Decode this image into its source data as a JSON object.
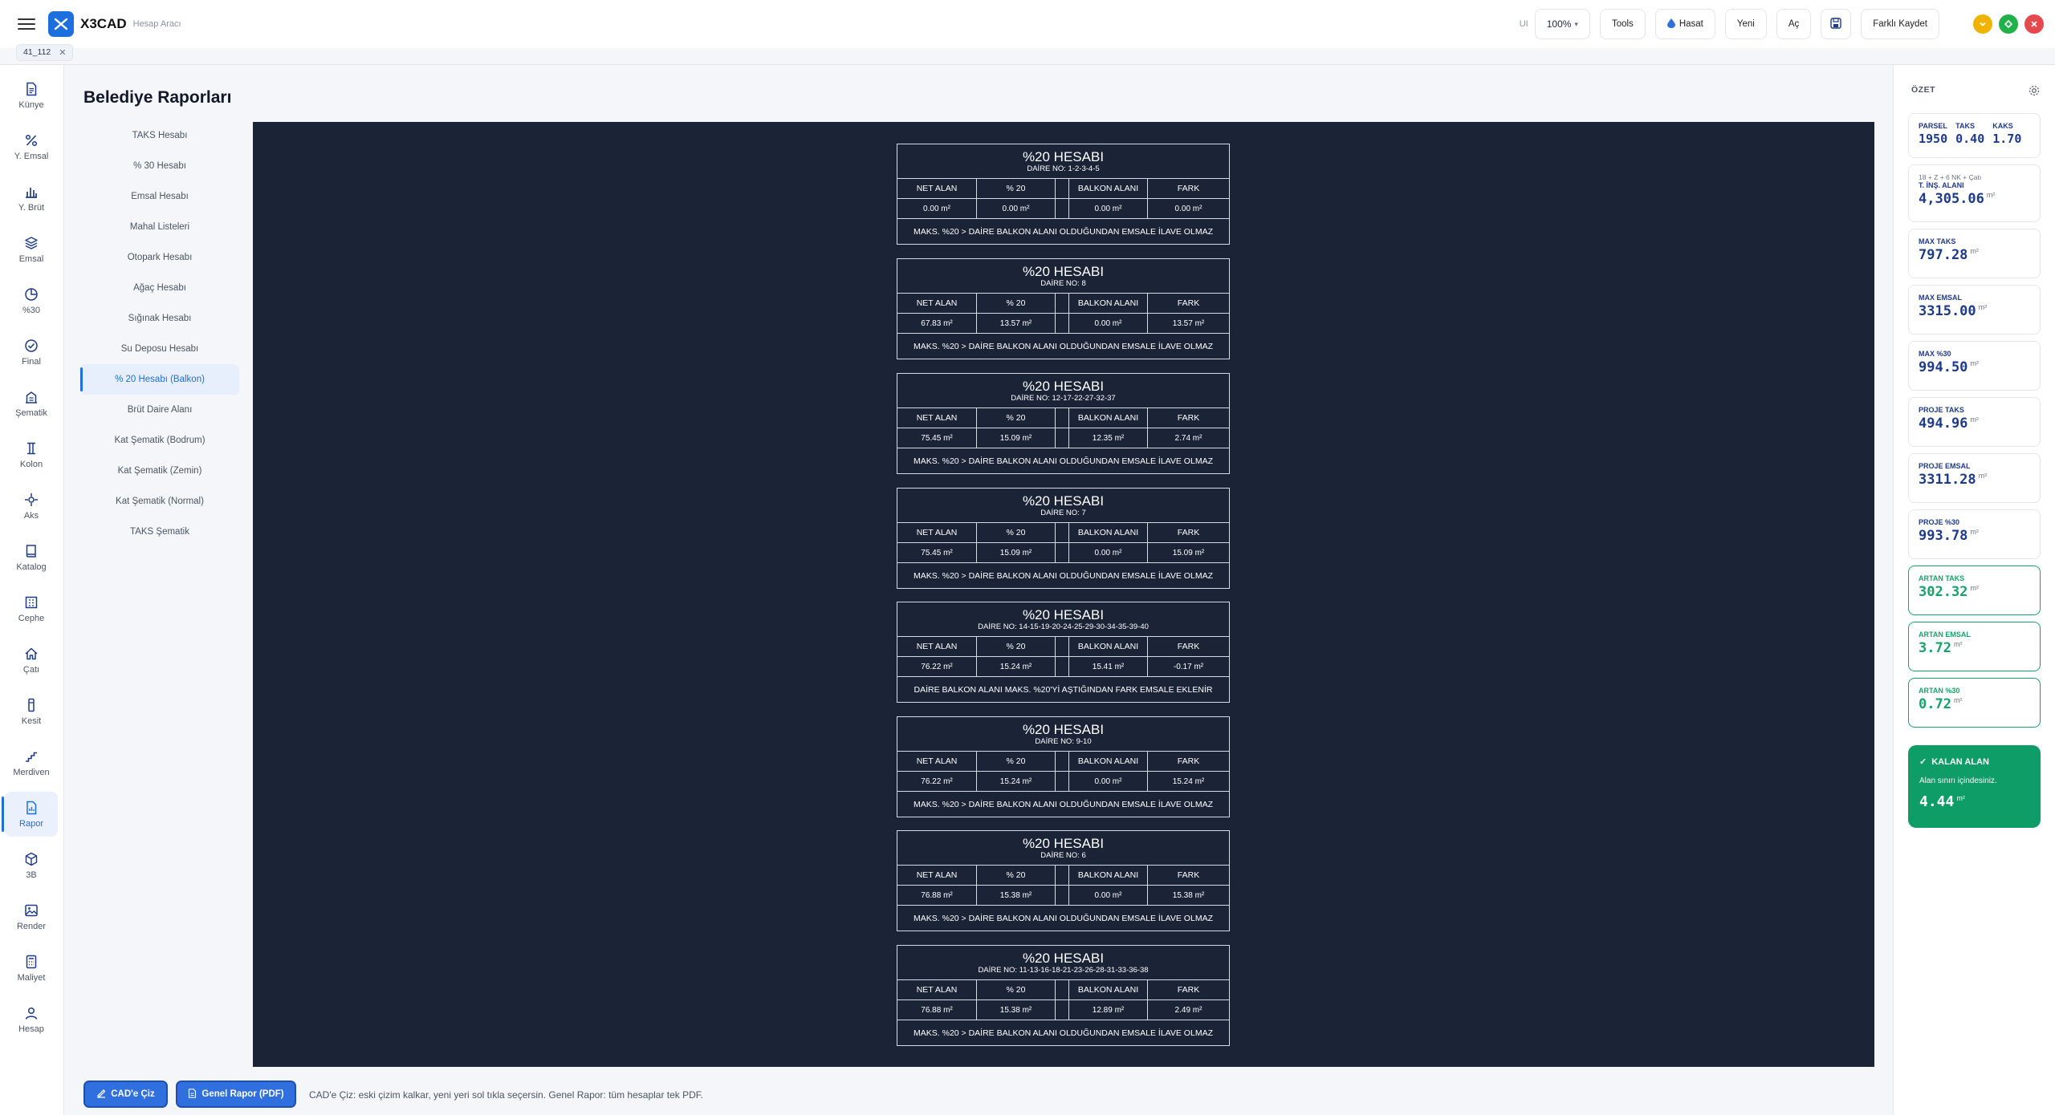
{
  "app": {
    "name": "X3CAD",
    "subtitle": "Hesap Aracı",
    "file_tab": "41_112",
    "ui_label": "UI",
    "zoom": "100%",
    "buttons": {
      "tools": "Tools",
      "hasat": "Hasat",
      "yeni": "Yeni",
      "ac": "Aç",
      "farkli_kaydet": "Farklı Kaydet"
    },
    "window_colors": {
      "minimize": "#f0b400",
      "maximize": "#22b04b",
      "close": "#e5484d"
    }
  },
  "sidebar": {
    "items": [
      {
        "label": "Künye",
        "icon": "document-icon"
      },
      {
        "label": "Y. Emsal",
        "icon": "percent-icon"
      },
      {
        "label": "Y. Brüt",
        "icon": "bar-chart-icon"
      },
      {
        "label": "Emsal",
        "icon": "layers-icon"
      },
      {
        "label": "%30",
        "icon": "pie-icon"
      },
      {
        "label": "Final",
        "icon": "check-circle-icon"
      },
      {
        "label": "Şematik",
        "icon": "building-icon"
      },
      {
        "label": "Kolon",
        "icon": "column-icon"
      },
      {
        "label": "Aks",
        "icon": "crosshair-icon"
      },
      {
        "label": "Katalog",
        "icon": "book-icon"
      },
      {
        "label": "Cephe",
        "icon": "facade-icon"
      },
      {
        "label": "Çatı",
        "icon": "home-icon"
      },
      {
        "label": "Kesit",
        "icon": "section-icon"
      },
      {
        "label": "Merdiven",
        "icon": "stairs-icon"
      },
      {
        "label": "Rapor",
        "icon": "report-icon",
        "active": true
      },
      {
        "label": "3B",
        "icon": "cube-icon"
      },
      {
        "label": "Render",
        "icon": "image-icon"
      },
      {
        "label": "Maliyet",
        "icon": "calculator-icon"
      },
      {
        "label": "Hesap",
        "icon": "user-icon"
      }
    ]
  },
  "page_title": "Belediye Raporları",
  "report_nav": [
    "TAKS Hesabı",
    "% 30 Hesabı",
    "Emsal Hesabı",
    "Mahal Listeleri",
    "Otopark Hesabı",
    "Ağaç Hesabı",
    "Sığınak Hesabı",
    "Su Deposu Hesabı",
    "% 20 Hesabı (Balkon)",
    "Brüt Daire Alanı",
    "Kat Şematik (Bodrum)",
    "Kat Şematik (Zemin)",
    "Kat Şematik (Normal)",
    "TAKS Şematik"
  ],
  "report_nav_active": 8,
  "table_headers": {
    "net_alan": "NET ALAN",
    "yuzde20": "% 20",
    "balkon": "BALKON ALANI",
    "fark": "FARK"
  },
  "reports": [
    {
      "title": "%20 HESABI",
      "daire": "DAİRE NO: 1-2-3-4-5",
      "net": "0.00 m²",
      "p20": "0.00 m²",
      "balkon": "0.00 m²",
      "fark": "0.00 m²",
      "note": "MAKS. %20 > DAİRE BALKON ALANI OLDUĞUNDAN EMSALE İLAVE OLMAZ"
    },
    {
      "title": "%20 HESABI",
      "daire": "DAİRE NO: 8",
      "net": "67.83 m²",
      "p20": "13.57 m²",
      "balkon": "0.00 m²",
      "fark": "13.57 m²",
      "note": "MAKS. %20 > DAİRE BALKON ALANI OLDUĞUNDAN EMSALE İLAVE OLMAZ"
    },
    {
      "title": "%20 HESABI",
      "daire": "DAİRE NO: 12-17-22-27-32-37",
      "net": "75.45 m²",
      "p20": "15.09 m²",
      "balkon": "12.35 m²",
      "fark": "2.74 m²",
      "note": "MAKS. %20 > DAİRE BALKON ALANI OLDUĞUNDAN EMSALE İLAVE OLMAZ"
    },
    {
      "title": "%20 HESABI",
      "daire": "DAİRE NO: 7",
      "net": "75.45 m²",
      "p20": "15.09 m²",
      "balkon": "0.00 m²",
      "fark": "15.09 m²",
      "note": "MAKS. %20 > DAİRE BALKON ALANI OLDUĞUNDAN EMSALE İLAVE OLMAZ"
    },
    {
      "title": "%20 HESABI",
      "daire": "DAİRE NO: 14-15-19-20-24-25-29-30-34-35-39-40",
      "net": "76.22 m²",
      "p20": "15.24 m²",
      "balkon": "15.41 m²",
      "fark": "-0.17 m²",
      "note": "DAİRE BALKON ALANI MAKS. %20'Yİ AŞTIĞINDAN FARK EMSALE EKLENİR"
    },
    {
      "title": "%20 HESABI",
      "daire": "DAİRE NO: 9-10",
      "net": "76.22 m²",
      "p20": "15.24 m²",
      "balkon": "0.00 m²",
      "fark": "15.24 m²",
      "note": "MAKS. %20 > DAİRE BALKON ALANI OLDUĞUNDAN EMSALE İLAVE OLMAZ"
    },
    {
      "title": "%20 HESABI",
      "daire": "DAİRE NO: 6",
      "net": "76.88 m²",
      "p20": "15.38 m²",
      "balkon": "0.00 m²",
      "fark": "15.38 m²",
      "note": "MAKS. %20 > DAİRE BALKON ALANI OLDUĞUNDAN EMSALE İLAVE OLMAZ"
    },
    {
      "title": "%20 HESABI",
      "daire": "DAİRE NO: 11-13-16-18-21-23-26-28-31-33-36-38",
      "net": "76.88 m²",
      "p20": "15.38 m²",
      "balkon": "12.89 m²",
      "fark": "2.49 m²",
      "note": "MAKS. %20 > DAİRE BALKON ALANI OLDUĞUNDAN EMSALE İLAVE OLMAZ"
    }
  ],
  "summary": {
    "heading": "ÖZET",
    "parsel": {
      "label": "PARSEL",
      "value": "1950"
    },
    "taks": {
      "label": "TAKS",
      "value": "0.40"
    },
    "kaks": {
      "label": "KAKS",
      "value": "1.70"
    },
    "t_ins": {
      "note": "18 + Z + 6 NK + Çatı",
      "label": "T. İNŞ. ALANI",
      "value": "4,305.06",
      "unit": "m²"
    },
    "cards": [
      {
        "label": "MAX TAKS",
        "value": "797.28",
        "unit": "m²",
        "green": false
      },
      {
        "label": "MAX EMSAL",
        "value": "3315.00",
        "unit": "m²",
        "green": false
      },
      {
        "label": "MAX %30",
        "value": "994.50",
        "unit": "m²",
        "green": false
      },
      {
        "label": "PROJE TAKS",
        "value": "494.96",
        "unit": "m²",
        "green": false
      },
      {
        "label": "PROJE EMSAL",
        "value": "3311.28",
        "unit": "m²",
        "green": false
      },
      {
        "label": "PROJE %30",
        "value": "993.78",
        "unit": "m²",
        "green": false
      },
      {
        "label": "ARTAN TAKS",
        "value": "302.32",
        "unit": "m²",
        "green": true
      },
      {
        "label": "ARTAN EMSAL",
        "value": "3.72",
        "unit": "m²",
        "green": true
      },
      {
        "label": "ARTAN %30",
        "value": "0.72",
        "unit": "m²",
        "green": true
      }
    ],
    "kalan": {
      "title": "KALAN ALAN",
      "note": "Alan sınırı içindesiniz.",
      "value": "4.44",
      "unit": "m²"
    }
  },
  "actions": {
    "cad_ciz": "CAD'e Çiz",
    "genel_rapor": "Genel Rapor (PDF)",
    "hint": "CAD'e Çiz: eski çizim kalkar, yeni yeri sol tıkla seçersin. Genel Rapor: tüm hesaplar tek PDF."
  },
  "colors": {
    "accent": "#1d6fe0",
    "canvas": "#1b2437",
    "green": "#16a36a"
  }
}
